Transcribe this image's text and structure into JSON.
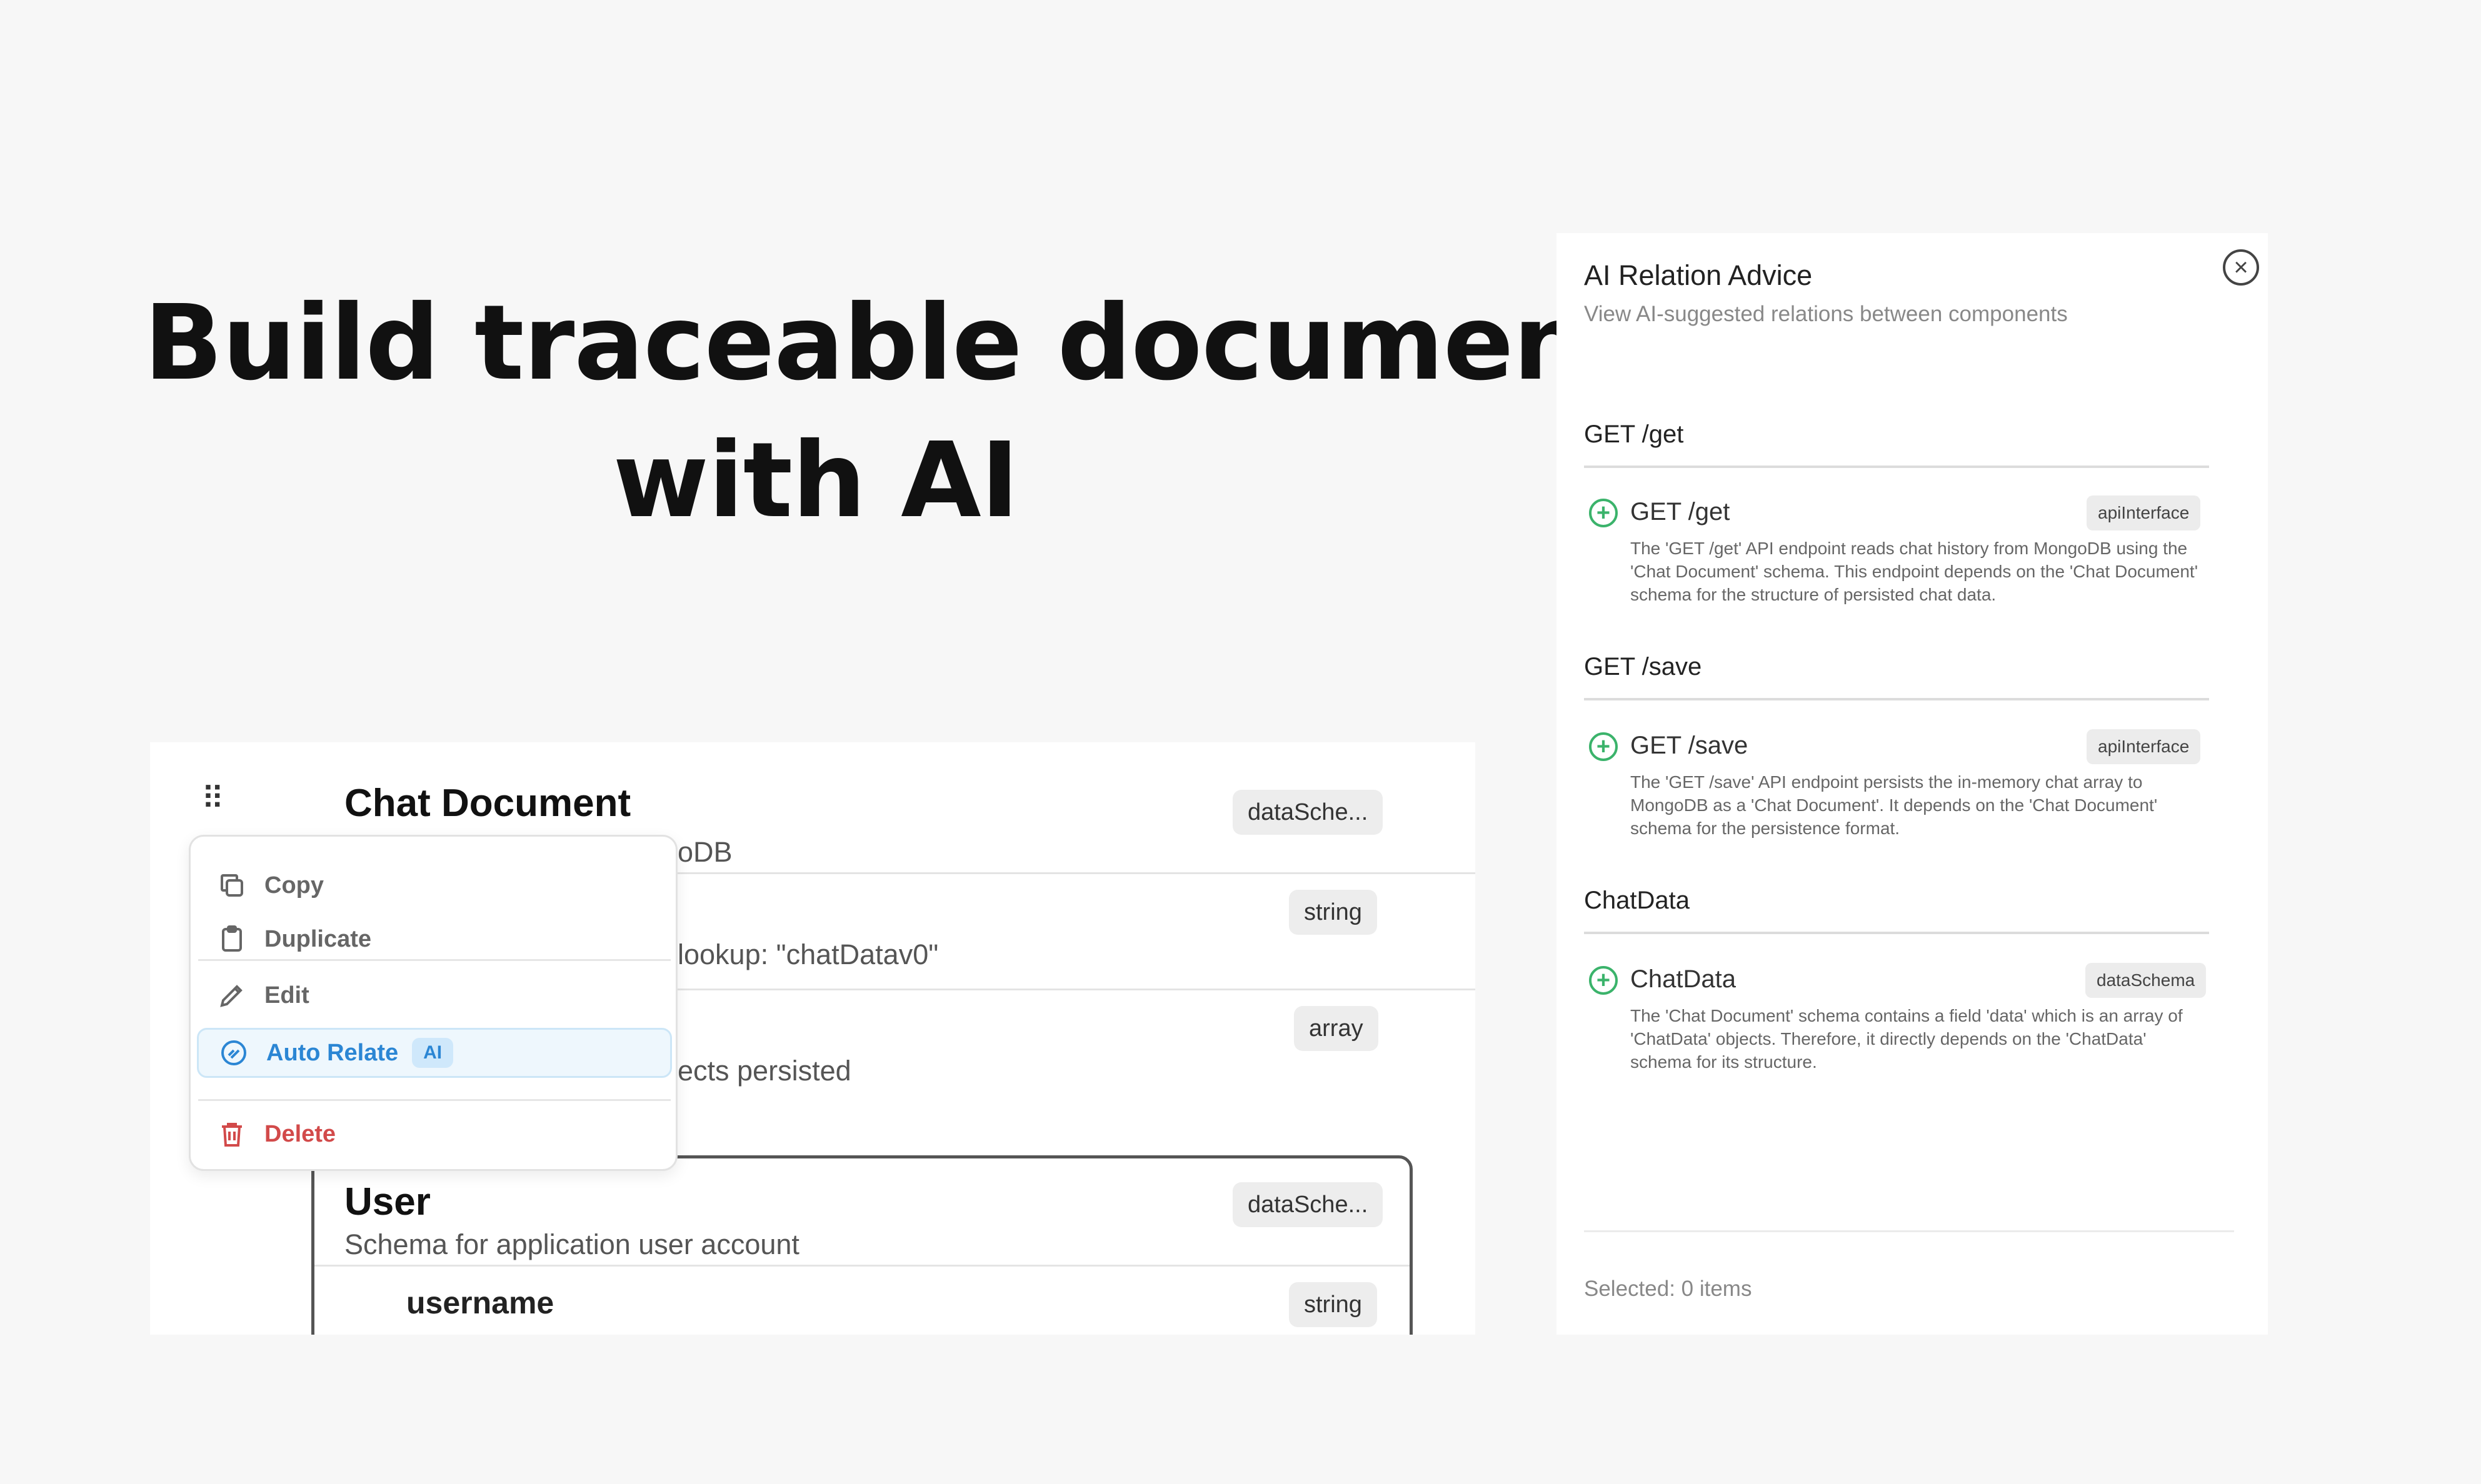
{
  "headline": {
    "line1": "Build traceable document",
    "line2": "with AI"
  },
  "editor": {
    "drag_icon": "⠿",
    "chat_doc": {
      "title": "Chat Document",
      "tag": "dataSche...",
      "subtext": "oDB"
    },
    "field1": {
      "tag": "string",
      "subtext": "lookup: \"chatDatav0\""
    },
    "field2": {
      "tag": "array",
      "subtext": "ects persisted"
    },
    "user": {
      "title": "User",
      "tag": "dataSche...",
      "subtext": "Schema for application user account"
    },
    "username": {
      "name": "username",
      "tag": "string"
    }
  },
  "menu": {
    "copy": "Copy",
    "duplicate": "Duplicate",
    "edit": "Edit",
    "auto_relate": "Auto Relate",
    "ai_badge": "AI",
    "delete": "Delete"
  },
  "panel": {
    "title": "AI Relation Advice",
    "subtitle": "View AI-suggested relations between components",
    "close_icon": "×",
    "groups": [
      {
        "heading": "GET /get",
        "item": "GET /get",
        "tag": "apiInterface",
        "desc": "The 'GET /get' API endpoint reads chat history from MongoDB using the 'Chat Document' schema. This endpoint depends on the 'Chat Document' schema for the structure of persisted chat data."
      },
      {
        "heading": "GET /save",
        "item": "GET /save",
        "tag": "apiInterface",
        "desc": "The 'GET /save' API endpoint persists the in-memory chat array to MongoDB as a 'Chat Document'. It depends on the 'Chat Document' schema for the persistence format."
      },
      {
        "heading": "ChatData",
        "item": "ChatData",
        "tag": "dataSchema",
        "desc": "The 'Chat Document' schema contains a field 'data' which is an array of 'ChatData' objects. Therefore, it directly depends on the 'ChatData' schema for its structure."
      }
    ],
    "plus_icon": "+",
    "footer": "Selected: 0 items"
  },
  "colors": {
    "accent": "#2b86d4",
    "danger": "#d24a4a",
    "success": "#3bb36b"
  }
}
